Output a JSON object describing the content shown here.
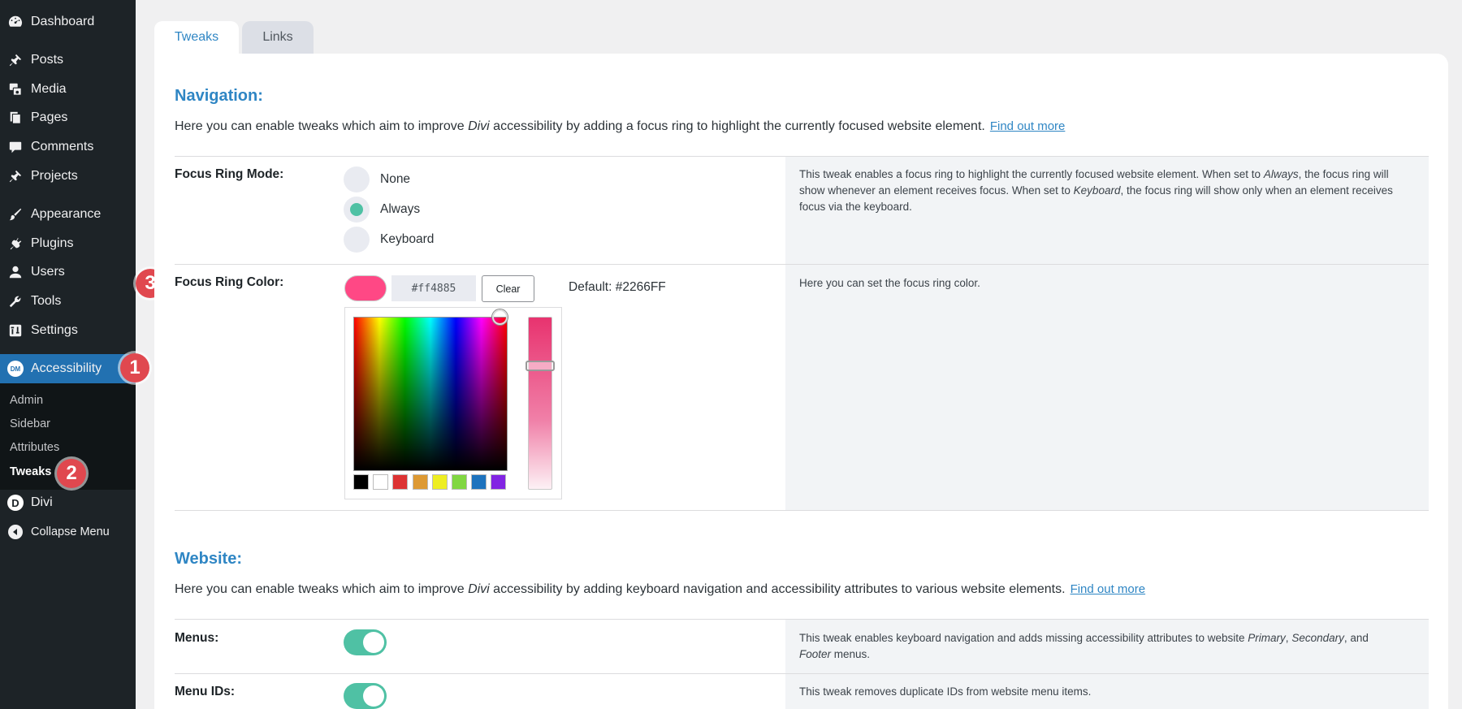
{
  "sidebar": {
    "items": [
      {
        "label": "Dashboard",
        "icon": "dashboard-icon"
      },
      {
        "label": "Posts",
        "icon": "pin-icon"
      },
      {
        "label": "Media",
        "icon": "media-icon"
      },
      {
        "label": "Pages",
        "icon": "pages-icon"
      },
      {
        "label": "Comments",
        "icon": "comment-icon"
      },
      {
        "label": "Projects",
        "icon": "pin-icon"
      },
      {
        "label": "Appearance",
        "icon": "paintbrush-icon"
      },
      {
        "label": "Plugins",
        "icon": "plugin-icon"
      },
      {
        "label": "Users",
        "icon": "user-icon"
      },
      {
        "label": "Tools",
        "icon": "wrench-icon"
      },
      {
        "label": "Settings",
        "icon": "settings-icon"
      },
      {
        "label": "Accessibility",
        "icon": "dm-icon",
        "icon_text": "DM"
      },
      {
        "label": "Divi",
        "icon": "divi-icon",
        "icon_text": "D"
      },
      {
        "label": "Collapse Menu",
        "icon": "collapse-icon"
      }
    ],
    "submenu": [
      "Admin",
      "Sidebar",
      "Attributes",
      "Tweaks"
    ],
    "active_color": "#2271b1"
  },
  "annotations": [
    "1",
    "2",
    "3"
  ],
  "tabs": [
    {
      "label": "Tweaks",
      "active": true
    },
    {
      "label": "Links",
      "active": false
    }
  ],
  "navigation": {
    "title": "Navigation:",
    "desc_before": "Here you can enable tweaks which aim to improve ",
    "desc_em": "Divi",
    "desc_after": " accessibility by adding a focus ring to highlight the currently focused website element.",
    "link": "Find out more"
  },
  "focus_ring_mode": {
    "label": "Focus Ring Mode:",
    "options": [
      "None",
      "Always",
      "Keyboard"
    ],
    "selected": "Always",
    "desc_1": "This tweak enables a focus ring to highlight the currently focused website element. When set to ",
    "desc_em1": "Always",
    "desc_2": ", the focus ring will show whenever an element receives focus. When set to ",
    "desc_em2": "Keyboard",
    "desc_3": ", the focus ring will show only when an element receives focus via the keyboard."
  },
  "focus_ring_color": {
    "label": "Focus Ring Color:",
    "value": "#ff4885",
    "clear_label": "Clear",
    "default_text": "Default: #2266FF",
    "desc": "Here you can set the focus ring color.",
    "palette": [
      "#000000",
      "#ffffff",
      "#dd3333",
      "#dd9933",
      "#eeee22",
      "#81d742",
      "#1e73be",
      "#8224e3"
    ]
  },
  "website": {
    "title": "Website:",
    "desc_before": "Here you can enable tweaks which aim to improve ",
    "desc_em": "Divi",
    "desc_after": " accessibility by adding keyboard navigation and accessibility attributes to various website elements.",
    "link": "Find out more"
  },
  "menus": {
    "label": "Menus:",
    "enabled": true,
    "desc_1": "This tweak enables keyboard navigation and adds missing accessibility attributes to website ",
    "desc_em1": "Primary",
    "desc_2": ", ",
    "desc_em2": "Secondary",
    "desc_3": ", and ",
    "desc_em3": "Footer",
    "desc_4": " menus."
  },
  "menu_ids": {
    "label": "Menu IDs:",
    "enabled": true,
    "desc": "This tweak removes duplicate IDs from website menu items."
  },
  "colors": {
    "accent": "#2f86c4",
    "toggle_on": "#4fc1a4",
    "badge": "#e0484f"
  }
}
